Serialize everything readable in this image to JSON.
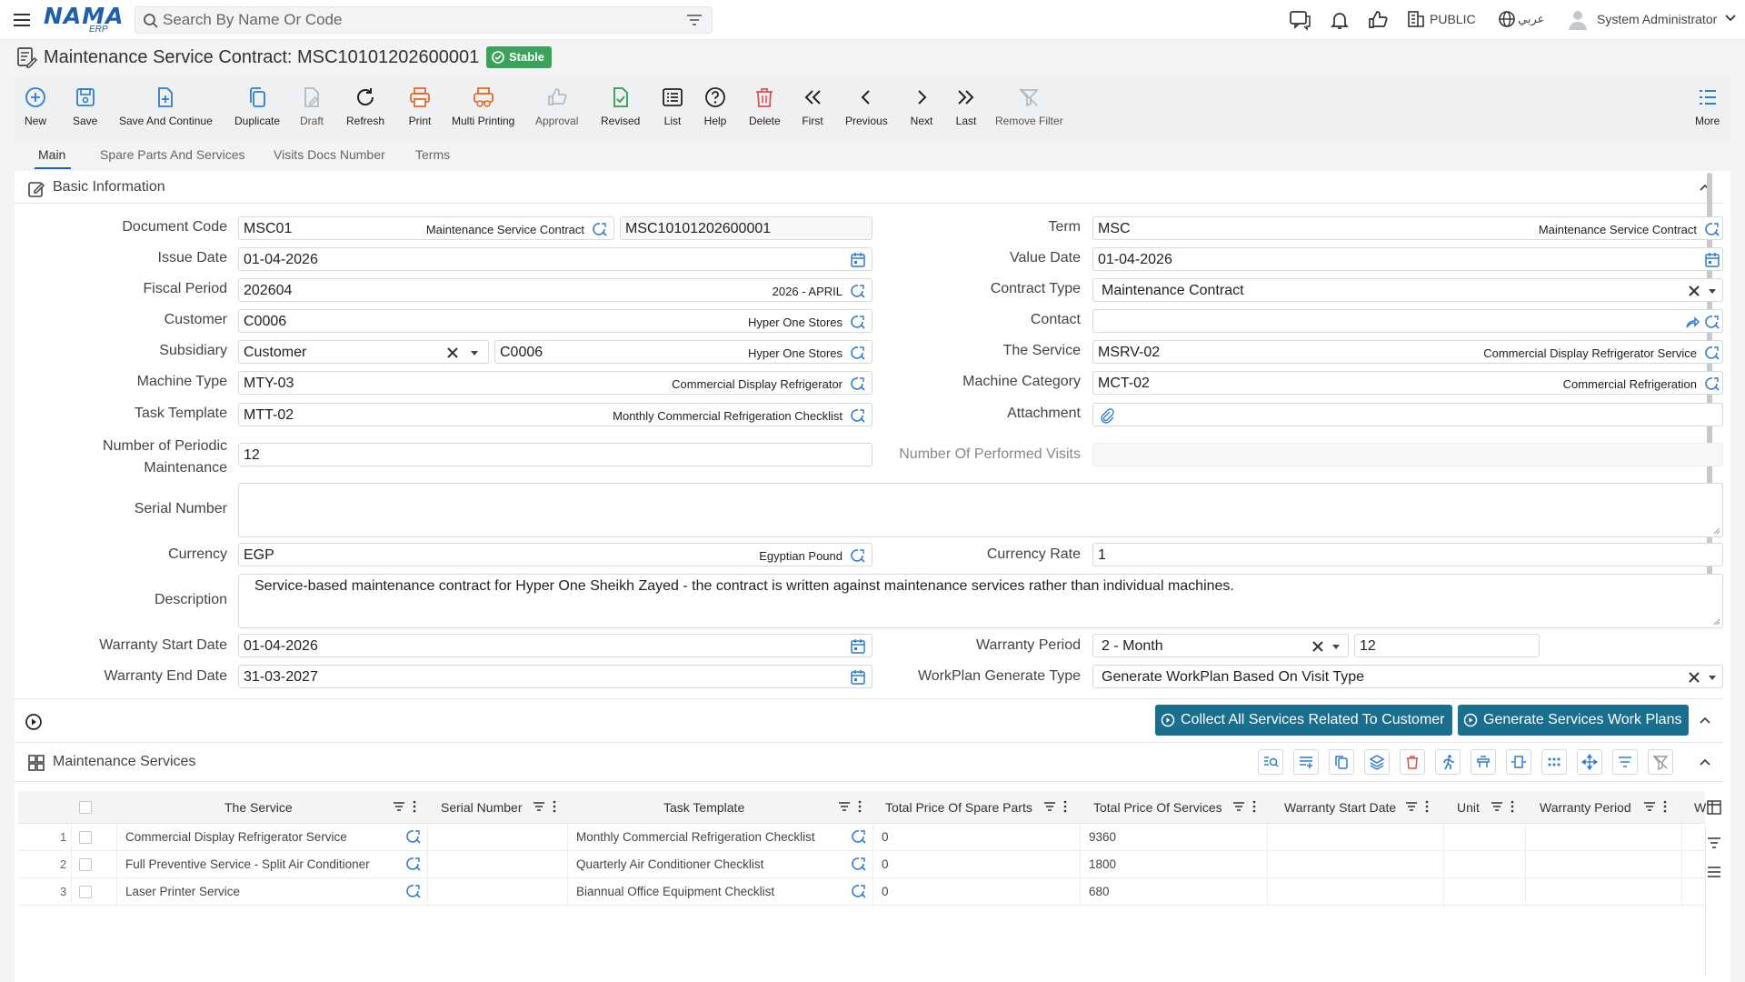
{
  "header": {
    "logo": "NAMA",
    "logo_sub": "ERP",
    "search_placeholder": "Search By Name Or Code",
    "public_label": "PUBLIC",
    "language_label": "عربي",
    "user_name": "System Administrator"
  },
  "page": {
    "title": "Maintenance Service Contract: MSC10101202600001",
    "status": "Stable"
  },
  "toolbar": {
    "new": "New",
    "save": "Save",
    "save_continue": "Save And Continue",
    "duplicate": "Duplicate",
    "draft": "Draft",
    "refresh": "Refresh",
    "print": "Print",
    "multi_printing": "Multi Printing",
    "approval": "Approval",
    "revised": "Revised",
    "list": "List",
    "help": "Help",
    "delete": "Delete",
    "first": "First",
    "previous": "Previous",
    "next": "Next",
    "last": "Last",
    "remove_filter": "Remove Filter",
    "more": "More"
  },
  "tabs": [
    "Main",
    "Spare Parts And Services",
    "Visits Docs Number",
    "Terms"
  ],
  "basic_info": {
    "section_title": "Basic Information",
    "document_code": {
      "label": "Document Code",
      "value": "MSC01",
      "desc": "Maintenance Service Contract",
      "number": "MSC10101202600001"
    },
    "term": {
      "label": "Term",
      "value": "MSC",
      "desc": "Maintenance Service Contract"
    },
    "issue_date": {
      "label": "Issue Date",
      "value": "01-04-2026"
    },
    "value_date": {
      "label": "Value Date",
      "value": "01-04-2026"
    },
    "fiscal_period": {
      "label": "Fiscal Period",
      "value": "202604",
      "desc": "2026 - APRIL"
    },
    "contract_type": {
      "label": "Contract Type",
      "value": "Maintenance Contract"
    },
    "customer": {
      "label": "Customer",
      "value": "C0006",
      "desc": "Hyper One Stores"
    },
    "contact": {
      "label": "Contact",
      "value": ""
    },
    "subsidiary": {
      "label": "Subsidiary",
      "type_value": "Customer",
      "value": "C0006",
      "desc": "Hyper One Stores"
    },
    "service": {
      "label": "The Service",
      "value": "MSRV-02",
      "desc": "Commercial Display Refrigerator Service"
    },
    "machine_type": {
      "label": "Machine Type",
      "value": "MTY-03",
      "desc": "Commercial Display Refrigerator"
    },
    "machine_category": {
      "label": "Machine Category",
      "value": "MCT-02",
      "desc": "Commercial Refrigeration"
    },
    "task_template": {
      "label": "Task Template",
      "value": "MTT-02",
      "desc": "Monthly Commercial Refrigeration Checklist"
    },
    "attachment": {
      "label": "Attachment"
    },
    "periodic_maintenance": {
      "label_line1": "Number of Periodic",
      "label_line2": "Maintenance",
      "value": "12"
    },
    "performed_visits": {
      "label": "Number Of Performed Visits",
      "value": ""
    },
    "serial_number": {
      "label": "Serial Number",
      "value": ""
    },
    "currency": {
      "label": "Currency",
      "value": "EGP",
      "desc": "Egyptian Pound"
    },
    "currency_rate": {
      "label": "Currency Rate",
      "value": "1"
    },
    "description": {
      "label": "Description",
      "value": "Service-based maintenance contract for Hyper One Sheikh Zayed - the contract is written against maintenance services rather than individual machines."
    },
    "warranty_start": {
      "label": "Warranty Start Date",
      "value": "01-04-2026"
    },
    "warranty_period": {
      "label": "Warranty Period",
      "unit": "2 - Month",
      "value": "12"
    },
    "warranty_end": {
      "label": "Warranty End Date",
      "value": "31-03-2027"
    },
    "workplan_type": {
      "label": "WorkPlan Generate Type",
      "value": "Generate WorkPlan Based On Visit Type"
    }
  },
  "actions": {
    "collect": "Collect All Services Related To Customer",
    "generate": "Generate Services Work Plans"
  },
  "services_grid": {
    "section_title": "Maintenance Services",
    "columns": [
      "The Service",
      "Serial Number",
      "Task Template",
      "Total Price Of Spare Parts",
      "Total Price Of Services",
      "Warranty Start Date",
      "Unit",
      "Warranty Period",
      "W"
    ],
    "rows": [
      {
        "n": "1",
        "service": "Commercial Display Refrigerator Service",
        "serial": "",
        "template": "Monthly Commercial Refrigeration Checklist",
        "spare": "0",
        "services": "9360"
      },
      {
        "n": "2",
        "service": "Full Preventive Service - Split Air Conditioner",
        "serial": "",
        "template": "Quarterly Air Conditioner Checklist",
        "spare": "0",
        "services": "1800"
      },
      {
        "n": "3",
        "service": "Laser Printer Service",
        "serial": "",
        "template": "Biannual Office Equipment Checklist",
        "spare": "0",
        "services": "680"
      }
    ]
  },
  "colors": {
    "brand": "#1f5fad",
    "action": "#1a6e8e",
    "stable": "#3aa35b",
    "danger": "#d9534f",
    "icon_blue": "#2d7dd2"
  }
}
